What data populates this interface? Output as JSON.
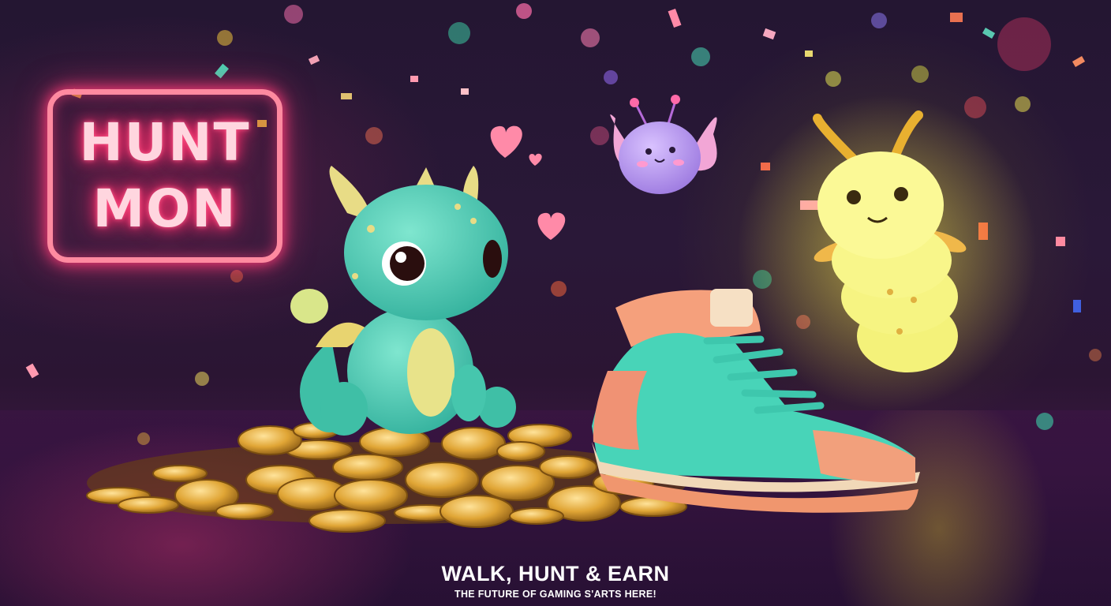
{
  "logo": {
    "line1": "HUNT",
    "line2": "MON",
    "glow_color": "#ff3c78"
  },
  "headline": "WALK, HUNT & EARN",
  "tagline": "THE FUTURE OF GAMING S'ARTS HERE!",
  "scene": {
    "characters": [
      "teal-baby-dragon",
      "purple-winged-creature",
      "glowing-yellow-caterpillar"
    ],
    "objects": [
      "gold-coin-pile",
      "sneaker",
      "hearts",
      "confetti"
    ]
  }
}
